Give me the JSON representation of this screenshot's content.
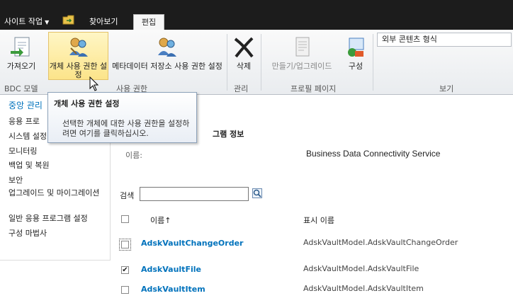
{
  "topbar": {
    "site_actions": "사이트 작업",
    "tabs": [
      {
        "label": "찾아보기"
      },
      {
        "label": "편집"
      }
    ]
  },
  "ribbon": {
    "buttons": {
      "import": "가져오기",
      "set_object_permissions": "개체 사용 권한 설정",
      "set_metadata_permissions": "메타데이터 저장소 사용 권한 설정",
      "delete": "삭제",
      "create_upgrade": "만들기/업그레이드",
      "configure": "구성"
    },
    "groups": {
      "bdc_models": "BDC 모델",
      "permissions": "사용 권한",
      "manage": "관리",
      "profile_pages": "프로필 페이지",
      "view": "보기"
    },
    "view_select": "외부 콘텐츠 형식"
  },
  "tooltip": {
    "title": "개체 사용 권한 설정",
    "body": "선택한 개체에 대한 사용 권한을 설정하려면 여기를 클릭하십시오."
  },
  "leftnav": {
    "items": [
      "중앙 관리",
      "응용 프로",
      "시스템 설정",
      "모니터링",
      "백업 및 복원",
      "보안",
      "업그레이드 및 마이그레이션",
      "일반 응용 프로그램 설정",
      "구성 마법사"
    ]
  },
  "main": {
    "section_title": "그램 정보",
    "name_label": "이름:",
    "name_value": "Business Data Connectivity Service",
    "search_label": "검색",
    "search_value": "",
    "col_name": "이름↑",
    "col_display": "표시 이름",
    "rows": [
      {
        "name": "AdskVaultChangeOrder",
        "display": "AdskVaultModel.AdskVaultChangeOrder",
        "checked": false
      },
      {
        "name": "AdskVaultFile",
        "display": "AdskVaultModel.AdskVaultFile",
        "checked": true
      },
      {
        "name": "AdskVaultItem",
        "display": "AdskVaultModel.AdskVaultItem",
        "checked": false
      }
    ]
  },
  "colors": {
    "topbar": "#1c1c1c",
    "link": "#0072bc",
    "active_button": "#fce48a"
  }
}
